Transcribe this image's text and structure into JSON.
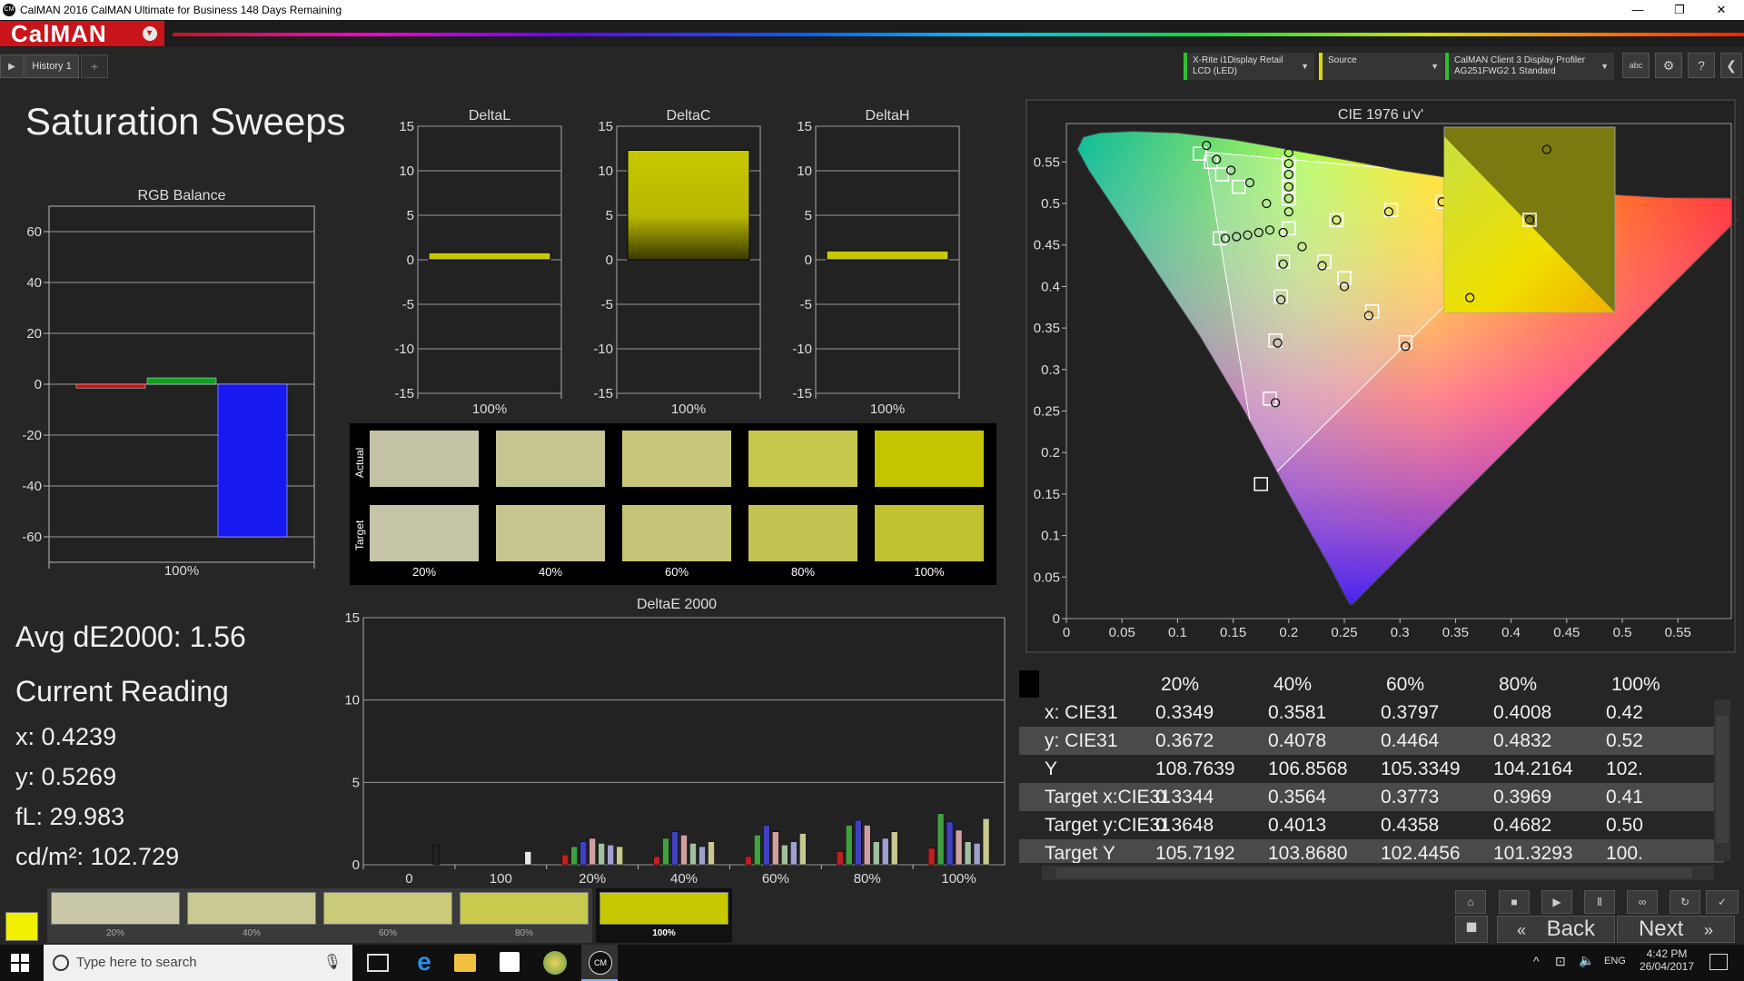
{
  "window": {
    "app_icon": "CM",
    "title": "CalMAN 2016 CalMAN Ultimate for Business 148 Days Remaining",
    "minimize": "—",
    "maximize": "❐",
    "close": "✕"
  },
  "brand": {
    "logo": "CalMAN",
    "logo_dropdown": "▾"
  },
  "tabs": {
    "play": "▶",
    "items": [
      {
        "label": "History 1"
      }
    ],
    "add": "+"
  },
  "devices": [
    {
      "line1": "X-Rite i1Display Retail",
      "line2": "LCD (LED)",
      "accent": "#30c030"
    },
    {
      "line1": "Source",
      "line2": "",
      "accent": "#d8d800"
    },
    {
      "line1": "CalMAN Client 3 Display Profiler",
      "line2": "AG251FWG2 1 Standard",
      "accent": "#30c030"
    }
  ],
  "toolbar": {
    "abc": "abc",
    "settings": "⚙",
    "help": "?",
    "collapse": "❮"
  },
  "page_title": "Saturation Sweeps",
  "rgb_balance": {
    "title": "RGB Balance",
    "yticks": [
      "60",
      "40",
      "20",
      "0",
      "-20",
      "-40",
      "-60"
    ],
    "ylim": [
      -70,
      70
    ],
    "xlabel": "100%",
    "bars": [
      {
        "name": "R",
        "value": -1.5,
        "color": "#d01010"
      },
      {
        "name": "G",
        "value": 2.5,
        "color": "#10a020"
      },
      {
        "name": "B",
        "value": -60,
        "color": "#1818f0"
      }
    ]
  },
  "delta_charts": [
    {
      "title": "DeltaL",
      "value": 0.8,
      "xlabel": "100%"
    },
    {
      "title": "DeltaC",
      "value": 12.3,
      "xlabel": "100%"
    },
    {
      "title": "DeltaH",
      "value": 1.0,
      "xlabel": "100%"
    }
  ],
  "delta_yticks": [
    "15",
    "10",
    "5",
    "0",
    "-5",
    "-10",
    "-15"
  ],
  "swatches": {
    "actual_label": "Actual",
    "target_label": "Target",
    "levels": [
      "20%",
      "40%",
      "60%",
      "80%",
      "100%"
    ],
    "actual_colors": [
      "#c4c3a6",
      "#c6c592",
      "#c8c67b",
      "#c7c64d",
      "#c5c400"
    ],
    "target_colors": [
      "#c5c4a7",
      "#c6c58f",
      "#c5c477",
      "#c3c250",
      "#c1c030"
    ]
  },
  "deltae_chart": {
    "title": "DeltaE 2000",
    "yticks": [
      "15",
      "10",
      "5",
      "0"
    ],
    "ylim": [
      0,
      15
    ],
    "categories": [
      "0",
      "100",
      "20%",
      "40%",
      "60%",
      "80%",
      "100%"
    ],
    "groups": [
      [
        {
          "c": "#222222",
          "v": 1.2
        }
      ],
      [
        {
          "c": "#e8e8e8",
          "v": 0.8
        }
      ],
      [
        {
          "c": "#c02020",
          "v": 0.6
        },
        {
          "c": "#40a040",
          "v": 1.1
        },
        {
          "c": "#4040c0",
          "v": 1.4
        },
        {
          "c": "#d0a0a0",
          "v": 1.6
        },
        {
          "c": "#a0c0a0",
          "v": 1.3
        },
        {
          "c": "#a0a0d0",
          "v": 1.2
        },
        {
          "c": "#c8c890",
          "v": 1.1
        }
      ],
      [
        {
          "c": "#c02020",
          "v": 0.5
        },
        {
          "c": "#40a040",
          "v": 1.6
        },
        {
          "c": "#4040c0",
          "v": 2.0
        },
        {
          "c": "#d0a0a0",
          "v": 1.8
        },
        {
          "c": "#a0c0a0",
          "v": 1.3
        },
        {
          "c": "#a0a0d0",
          "v": 1.1
        },
        {
          "c": "#c8c890",
          "v": 1.4
        }
      ],
      [
        {
          "c": "#c02020",
          "v": 0.5
        },
        {
          "c": "#40a040",
          "v": 1.8
        },
        {
          "c": "#4040c0",
          "v": 2.4
        },
        {
          "c": "#d0a0a0",
          "v": 2.0
        },
        {
          "c": "#a0c0a0",
          "v": 1.2
        },
        {
          "c": "#a0a0d0",
          "v": 1.4
        },
        {
          "c": "#c8c890",
          "v": 1.9
        }
      ],
      [
        {
          "c": "#c02020",
          "v": 0.8
        },
        {
          "c": "#40a040",
          "v": 2.4
        },
        {
          "c": "#4040c0",
          "v": 2.7
        },
        {
          "c": "#d0a0a0",
          "v": 2.4
        },
        {
          "c": "#a0c0a0",
          "v": 1.4
        },
        {
          "c": "#a0a0d0",
          "v": 1.6
        },
        {
          "c": "#c8c890",
          "v": 2.0
        }
      ],
      [
        {
          "c": "#c02020",
          "v": 1.0
        },
        {
          "c": "#40a040",
          "v": 3.1
        },
        {
          "c": "#4040c0",
          "v": 2.6
        },
        {
          "c": "#d0a0a0",
          "v": 2.1
        },
        {
          "c": "#a0c0a0",
          "v": 1.4
        },
        {
          "c": "#a0a0d0",
          "v": 1.3
        },
        {
          "c": "#c8c890",
          "v": 2.8
        }
      ]
    ]
  },
  "summary": {
    "avg_de": "Avg dE2000: 1.56",
    "current_reading": "Current Reading",
    "x": "x: 0.4239",
    "y": "y: 0.5269",
    "fl": "fL: 29.983",
    "cdm2": "cd/m²: 102.729"
  },
  "cie_chart": {
    "title": "CIE 1976 u'v'",
    "xticks": [
      "0",
      "0.05",
      "0.1",
      "0.15",
      "0.2",
      "0.25",
      "0.3",
      "0.35",
      "0.4",
      "0.45",
      "0.5",
      "0.55"
    ],
    "yticks": [
      "0.55",
      "0.5",
      "0.45",
      "0.4",
      "0.35",
      "0.3",
      "0.25",
      "0.2",
      "0.15",
      "0.1",
      "0.05",
      "0"
    ],
    "xlim": [
      0,
      0.6
    ],
    "ylim": [
      0,
      0.6
    ],
    "targets": [
      [
        0.12,
        0.56
      ],
      [
        0.13,
        0.55
      ],
      [
        0.14,
        0.535
      ],
      [
        0.155,
        0.52
      ],
      [
        0.2,
        0.548
      ],
      [
        0.2,
        0.535
      ],
      [
        0.2,
        0.52
      ],
      [
        0.2,
        0.506
      ],
      [
        0.2,
        0.47
      ],
      [
        0.195,
        0.43
      ],
      [
        0.193,
        0.388
      ],
      [
        0.188,
        0.335
      ],
      [
        0.183,
        0.265
      ],
      [
        0.175,
        0.162
      ],
      [
        0.138,
        0.458
      ],
      [
        0.232,
        0.43
      ],
      [
        0.25,
        0.41
      ],
      [
        0.275,
        0.37
      ],
      [
        0.305,
        0.333
      ],
      [
        0.243,
        0.48
      ],
      [
        0.292,
        0.492
      ],
      [
        0.338,
        0.502
      ],
      [
        0.39,
        0.511
      ]
    ],
    "measured": [
      [
        0.126,
        0.57
      ],
      [
        0.135,
        0.553
      ],
      [
        0.148,
        0.54
      ],
      [
        0.165,
        0.525
      ],
      [
        0.18,
        0.5
      ],
      [
        0.2,
        0.561
      ],
      [
        0.2,
        0.548
      ],
      [
        0.2,
        0.535
      ],
      [
        0.2,
        0.52
      ],
      [
        0.2,
        0.506
      ],
      [
        0.2,
        0.49
      ],
      [
        0.195,
        0.465
      ],
      [
        0.195,
        0.427
      ],
      [
        0.193,
        0.384
      ],
      [
        0.19,
        0.332
      ],
      [
        0.188,
        0.26
      ],
      [
        0.143,
        0.458
      ],
      [
        0.153,
        0.46
      ],
      [
        0.163,
        0.462
      ],
      [
        0.173,
        0.465
      ],
      [
        0.183,
        0.468
      ],
      [
        0.212,
        0.448
      ],
      [
        0.23,
        0.425
      ],
      [
        0.25,
        0.4
      ],
      [
        0.272,
        0.365
      ],
      [
        0.305,
        0.328
      ],
      [
        0.243,
        0.48
      ],
      [
        0.29,
        0.49
      ],
      [
        0.338,
        0.502
      ],
      [
        0.39,
        0.51
      ]
    ],
    "zoom_targets": [
      [
        0.5,
        0.5
      ]
    ],
    "zoom_measured": [
      [
        0.6,
        0.88
      ],
      [
        0.15,
        0.08
      ],
      [
        0.5,
        0.5
      ]
    ]
  },
  "results_table": {
    "columns": [
      "20%",
      "40%",
      "60%",
      "80%",
      "100%"
    ],
    "rows": [
      {
        "label": "x: CIE31",
        "values": [
          "0.3349",
          "0.3581",
          "0.3797",
          "0.4008",
          "0.42"
        ]
      },
      {
        "label": "y: CIE31",
        "values": [
          "0.3672",
          "0.4078",
          "0.4464",
          "0.4832",
          "0.52"
        ]
      },
      {
        "label": "Y",
        "values": [
          "108.7639",
          "106.8568",
          "105.3349",
          "104.2164",
          "102."
        ]
      },
      {
        "label": "Target x:CIE31",
        "values": [
          "0.3344",
          "0.3564",
          "0.3773",
          "0.3969",
          "0.41"
        ]
      },
      {
        "label": "Target y:CIE31",
        "values": [
          "0.3648",
          "0.4013",
          "0.4358",
          "0.4682",
          "0.50"
        ]
      },
      {
        "label": "Target Y",
        "values": [
          "105.7192",
          "103.8680",
          "102.4456",
          "101.3293",
          "100."
        ]
      }
    ]
  },
  "bottom_swatches": {
    "current_color": "#f0f000",
    "items": [
      {
        "label": "20%",
        "color": "#c8c8a8"
      },
      {
        "label": "40%",
        "color": "#c9c993"
      },
      {
        "label": "60%",
        "color": "#cacb78"
      },
      {
        "label": "80%",
        "color": "#c9c94e"
      },
      {
        "label": "100%",
        "color": "#c8c800"
      }
    ]
  },
  "nav": {
    "back": "Back",
    "next": "Next",
    "back_arrow": "«",
    "next_arrow": "»"
  },
  "taskbar": {
    "search_placeholder": "Type here to search",
    "lang": "ENG",
    "time": "4:42 PM",
    "date": "26/04/2017"
  }
}
